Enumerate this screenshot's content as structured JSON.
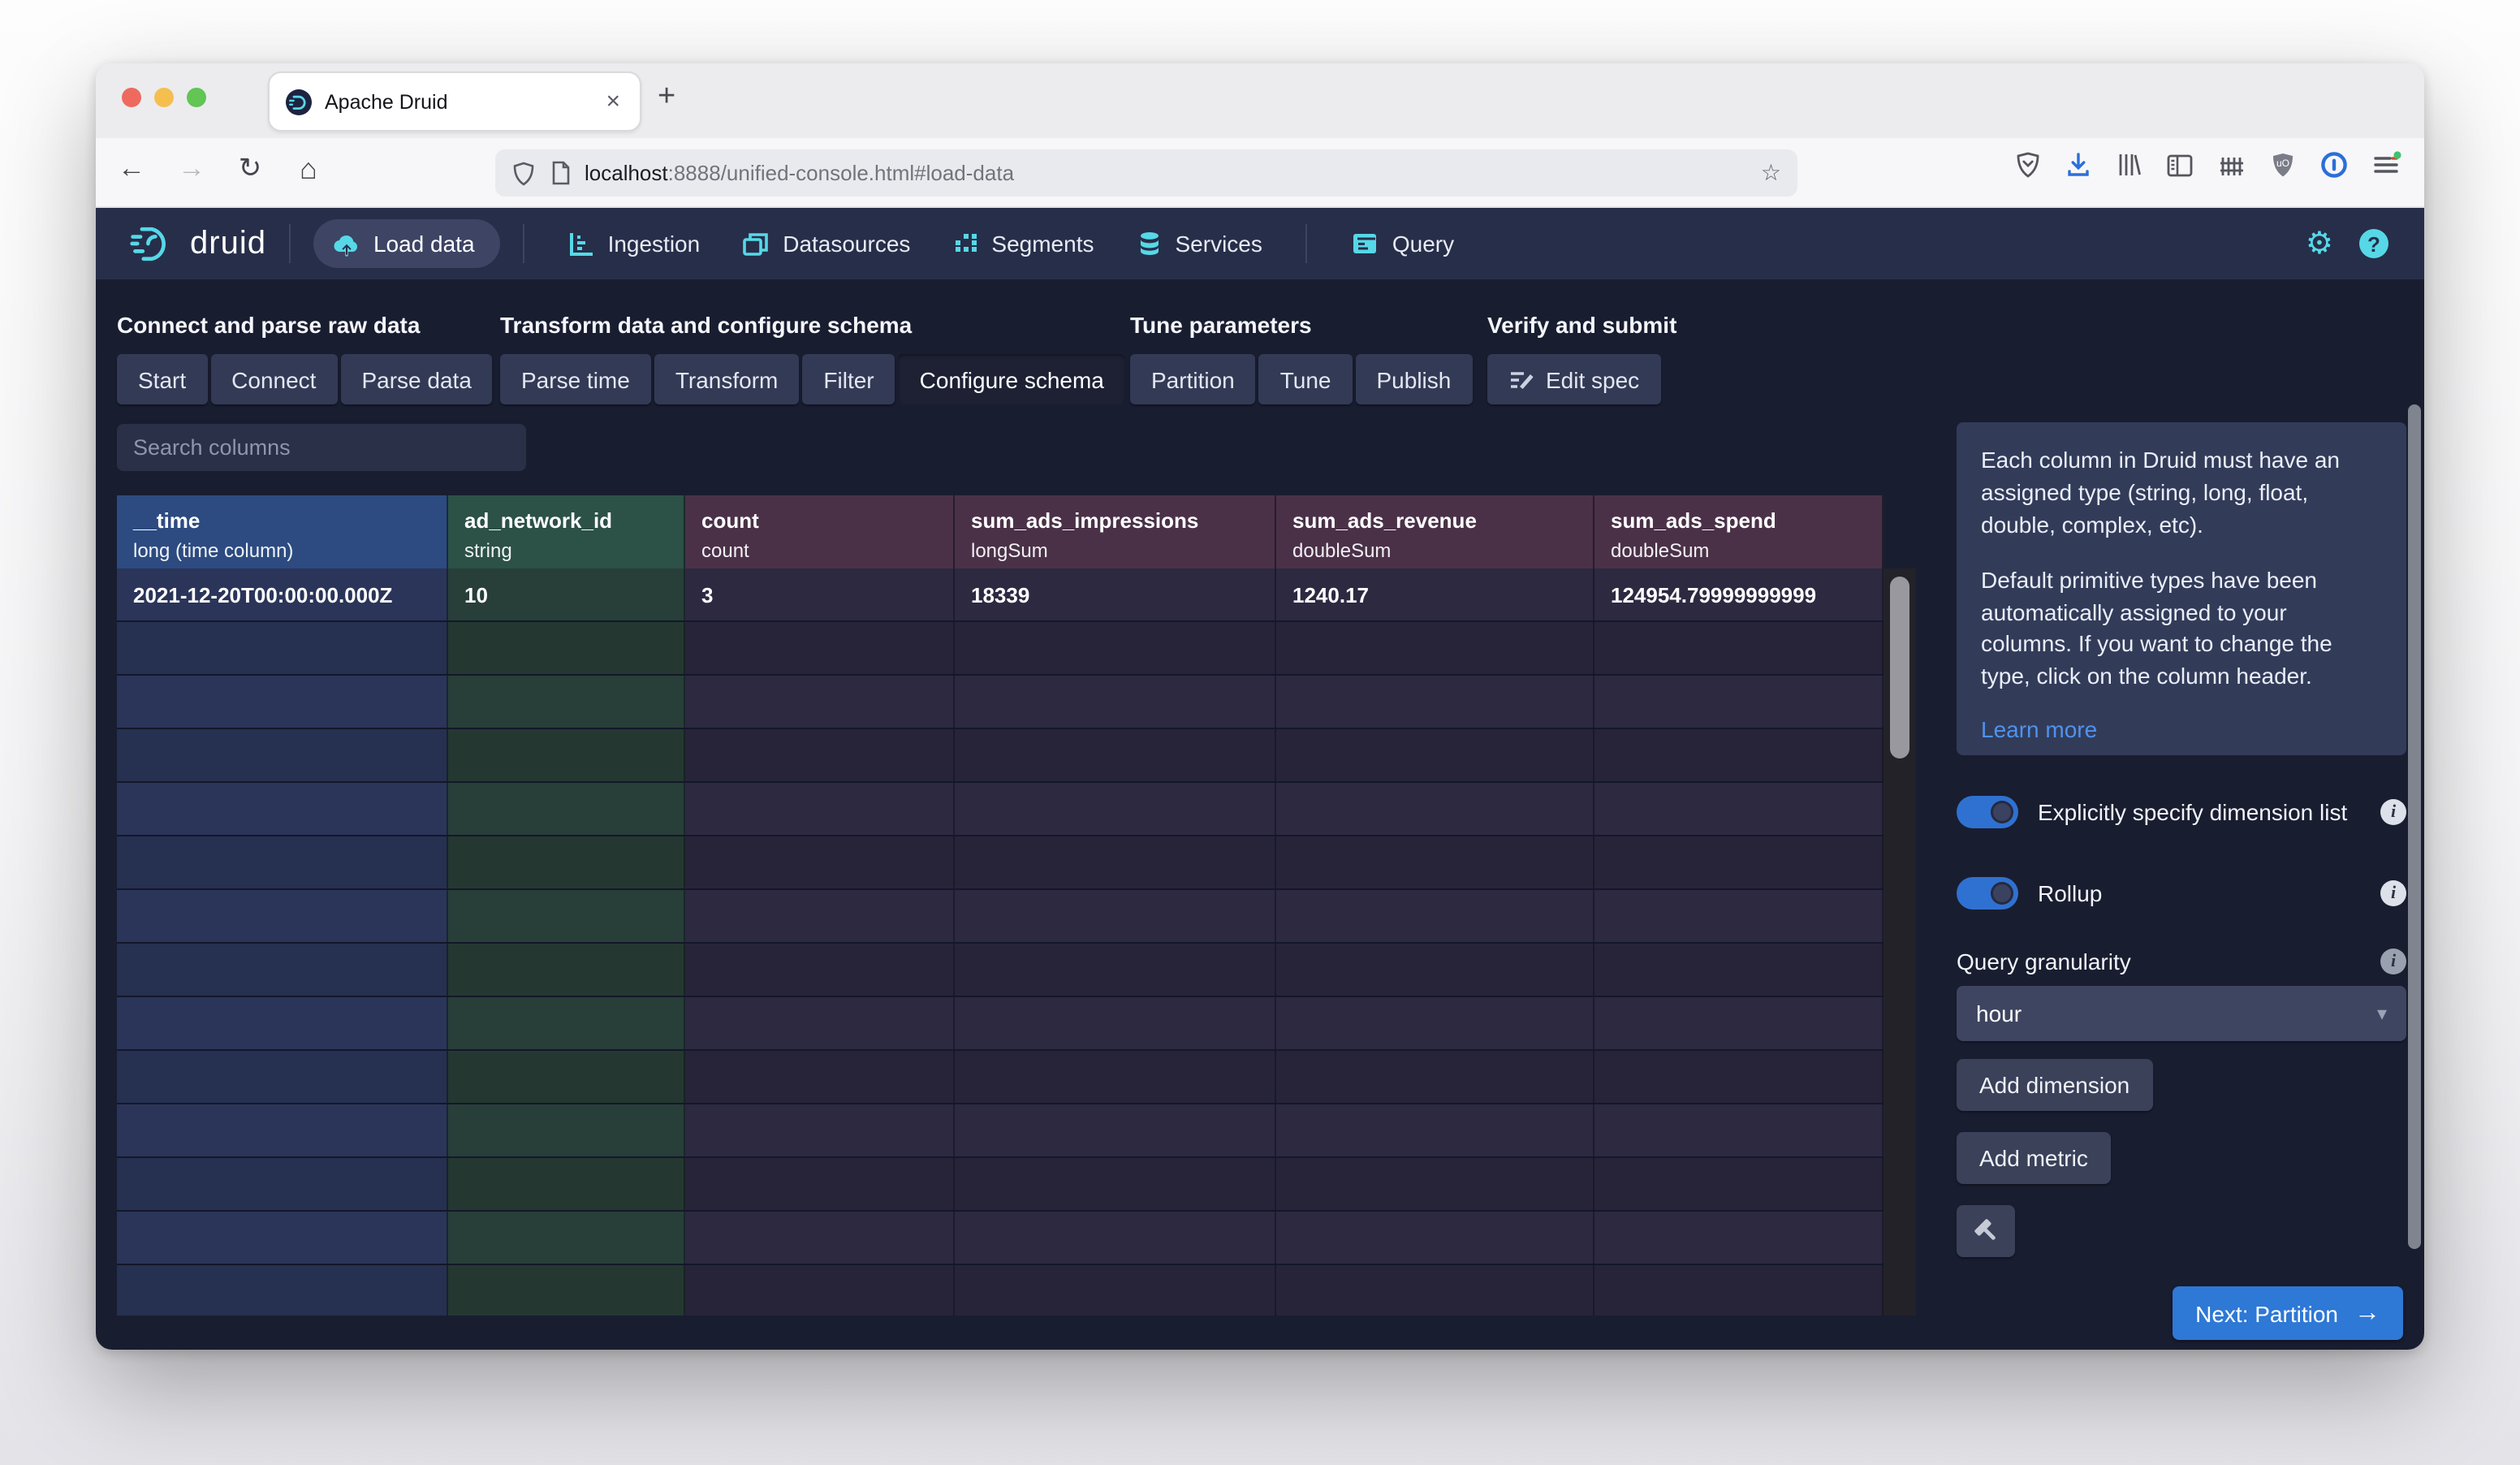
{
  "browser": {
    "tab_title": "Apache Druid",
    "url_host": "localhost",
    "url_rest": ":8888/unified-console.html#load-data"
  },
  "glyphs": {
    "close": "×",
    "new_tab": "+",
    "back": "←",
    "forward": "→",
    "reload": "↻",
    "home": "⌂",
    "star": "☆",
    "gear": "⚙",
    "help": "?",
    "caret": "▾",
    "info": "i",
    "next_arrow": "→"
  },
  "nav": {
    "brand": "druid",
    "items": [
      {
        "label": "Load data",
        "active": true
      },
      {
        "label": "Ingestion"
      },
      {
        "label": "Datasources"
      },
      {
        "label": "Segments"
      },
      {
        "label": "Services"
      },
      {
        "label": "Query"
      }
    ]
  },
  "steps": {
    "groups": [
      {
        "label": "Connect and parse raw data",
        "buttons": [
          "Start",
          "Connect",
          "Parse data"
        ]
      },
      {
        "label": "Transform data and configure schema",
        "buttons": [
          "Parse time",
          "Transform",
          "Filter",
          "Configure schema"
        ],
        "active": "Configure schema"
      },
      {
        "label": "Tune parameters",
        "buttons": [
          "Partition",
          "Tune",
          "Publish"
        ]
      },
      {
        "label": "Verify and submit",
        "buttons": [
          "Edit spec"
        ]
      }
    ]
  },
  "search": {
    "placeholder": "Search columns"
  },
  "table": {
    "columns": [
      {
        "name": "__time",
        "type": "long (time column)",
        "kind": "time"
      },
      {
        "name": "ad_network_id",
        "type": "string",
        "kind": "dim"
      },
      {
        "name": "count",
        "type": "count",
        "kind": "met"
      },
      {
        "name": "sum_ads_impressions",
        "type": "longSum",
        "kind": "met"
      },
      {
        "name": "sum_ads_revenue",
        "type": "doubleSum",
        "kind": "met"
      },
      {
        "name": "sum_ads_spend",
        "type": "doubleSum",
        "kind": "met"
      }
    ],
    "rows": [
      [
        "2021-12-20T00:00:00.000Z",
        "10",
        "3",
        "18339",
        "1240.17",
        "124954.79999999999"
      ]
    ],
    "empty_row_count": 15
  },
  "side_panel": {
    "callout": {
      "p1": "Each column in Druid must have an assigned type (string, long, float, double, complex, etc).",
      "p2": "Default primitive types have been automatically assigned to your columns. If you want to change the type, click on the column header.",
      "link": "Learn more"
    },
    "toggles": [
      {
        "label": "Explicitly specify dimension list",
        "on": true
      },
      {
        "label": "Rollup",
        "on": true
      }
    ],
    "granularity": {
      "label": "Query granularity",
      "value": "hour"
    },
    "add_dimension": "Add dimension",
    "add_metric": "Add metric",
    "next_button": "Next: Partition"
  },
  "colors": {
    "accent_cyan": "#56d8e7",
    "nav_bg": "#272e49",
    "app_bg": "#191d30",
    "header_time": "#2d4b81",
    "header_dimension": "#2c5146",
    "header_metric": "#4a3148",
    "toggle_blue": "#2f71d1",
    "primary_button_blue": "#2e78d6",
    "link_blue": "#4f92ee"
  }
}
